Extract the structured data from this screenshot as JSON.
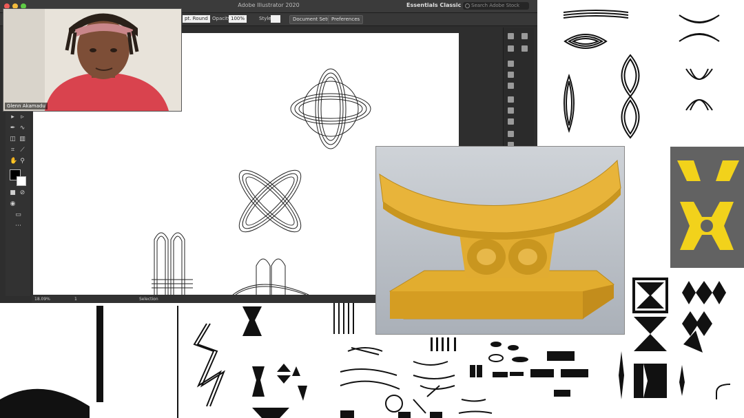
{
  "app": {
    "title": "Adobe Illustrator 2020",
    "workspace": "Essentials Classic",
    "search_placeholder": "Search Adobe Stock"
  },
  "control_bar": {
    "stroke_profile": "pt. Round",
    "opacity_label": "Opacity:",
    "opacity_value": "100%",
    "style_label": "Style:",
    "document_setup": "Document Setup",
    "preferences": "Preferences"
  },
  "status_bar": {
    "zoom": "18.09%",
    "artboard_number": "1",
    "tool": "Selection"
  },
  "webcam": {
    "name": "Glenn Akamadu"
  },
  "colors": {
    "window_dark": "#2e2e2e",
    "stool_yellow": "#e8b43a",
    "panel_gray": "#626262",
    "shirt_red": "#d9434e",
    "adinkra_yellow": "#f2d21b"
  }
}
